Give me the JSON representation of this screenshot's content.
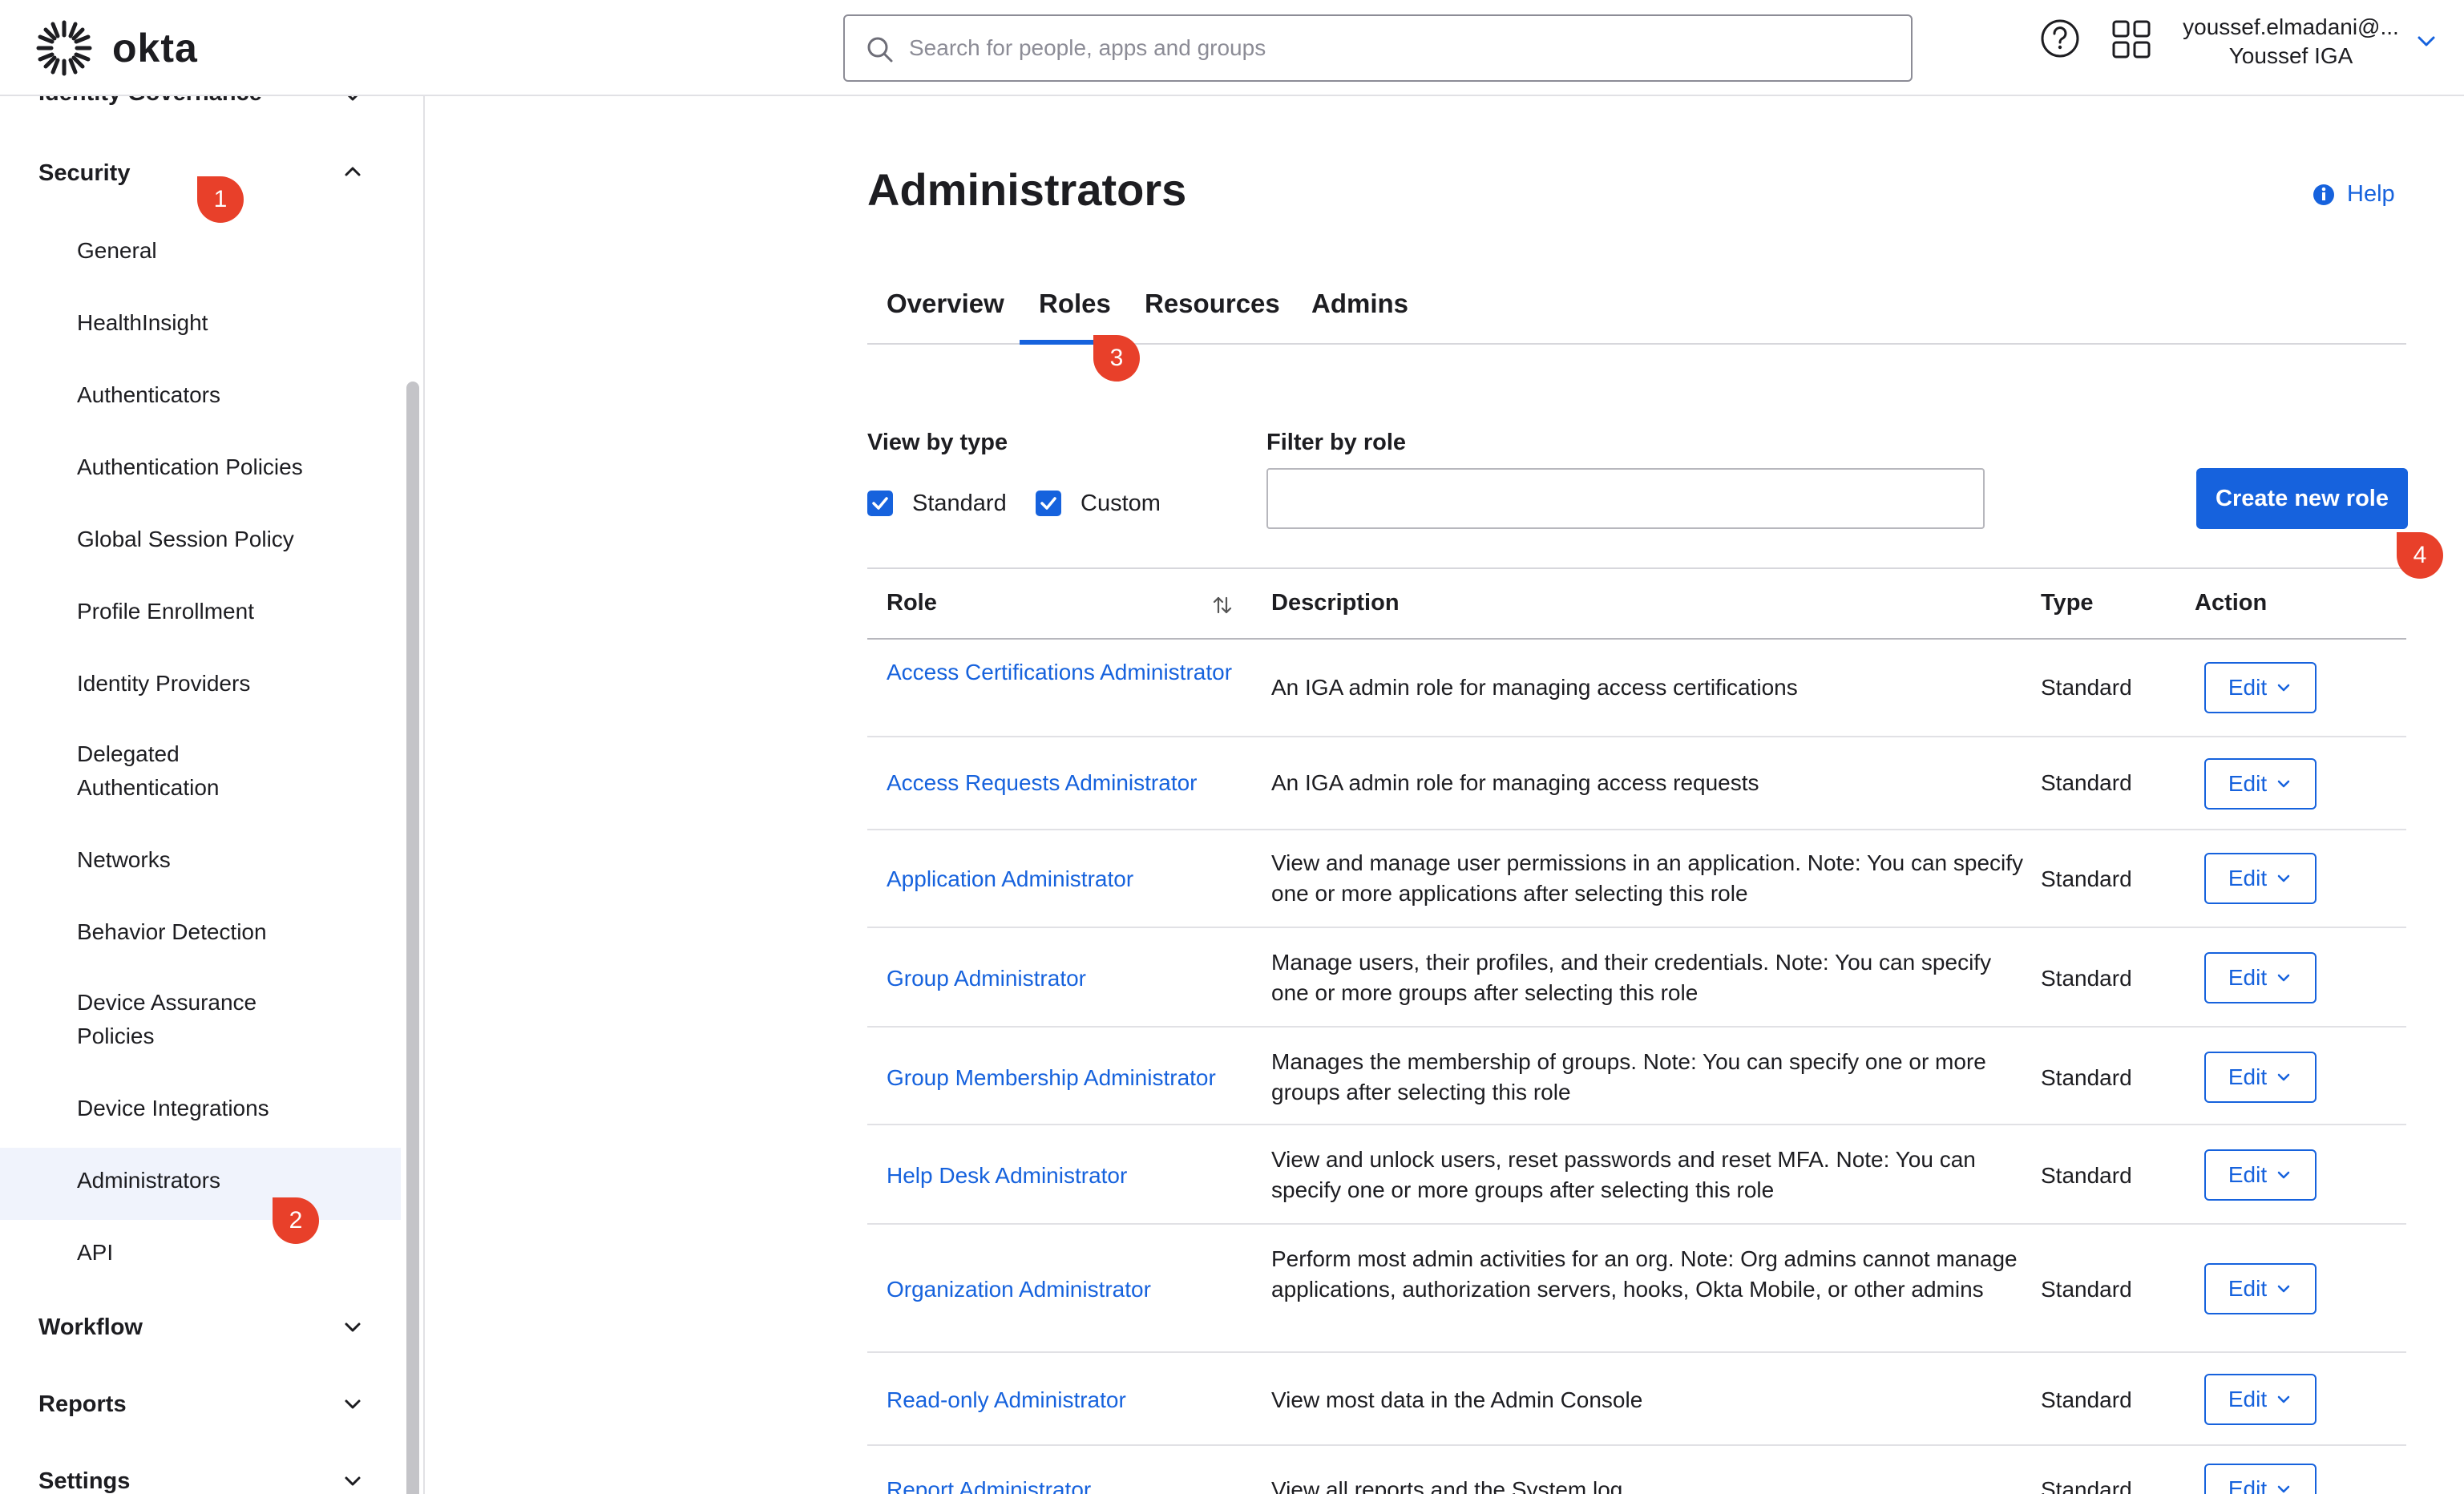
{
  "header": {
    "logo_text": "okta",
    "search_placeholder": "Search for people, apps and groups",
    "user_email": "youssef.elmadani@...",
    "user_org": "Youssef IGA"
  },
  "sidebar": {
    "partial_section": "Identity Governance",
    "security_label": "Security",
    "security_items": [
      "General",
      "HealthInsight",
      "Authenticators",
      "Authentication Policies",
      "Global Session Policy",
      "Profile Enrollment",
      "Identity Providers",
      "Delegated Authentication",
      "Networks",
      "Behavior Detection",
      "Device Assurance Policies",
      "Device Integrations",
      "Administrators",
      "API"
    ],
    "active_item": "Administrators",
    "sections_below": [
      "Workflow",
      "Reports",
      "Settings"
    ]
  },
  "page": {
    "title": "Administrators",
    "help_label": "Help",
    "tabs": [
      "Overview",
      "Roles",
      "Resources",
      "Admins"
    ],
    "active_tab": "Roles"
  },
  "filters": {
    "view_by_type_label": "View by type",
    "standard_label": "Standard",
    "custom_label": "Custom",
    "standard_checked": true,
    "custom_checked": true,
    "filter_by_role_label": "Filter by role",
    "filter_value": "",
    "create_button": "Create new role"
  },
  "table": {
    "columns": [
      "Role",
      "Description",
      "Type",
      "Action"
    ],
    "rows": [
      {
        "role": "Access Certifications Administrator",
        "description": "An IGA admin role for managing access certifications",
        "type": "Standard",
        "action": "Edit"
      },
      {
        "role": "Access Requests Administrator",
        "description": "An IGA admin role for managing access requests",
        "type": "Standard",
        "action": "Edit"
      },
      {
        "role": "Application Administrator",
        "description": "View and manage user permissions in an application. Note: You can specify one or more applications after selecting this role",
        "type": "Standard",
        "action": "Edit"
      },
      {
        "role": "Group Administrator",
        "description": "Manage users, their profiles, and their credentials. Note: You can specify one or more groups after selecting this role",
        "type": "Standard",
        "action": "Edit"
      },
      {
        "role": "Group Membership Administrator",
        "description": "Manages the membership of groups. Note: You can specify one or more groups after selecting this role",
        "type": "Standard",
        "action": "Edit"
      },
      {
        "role": "Help Desk Administrator",
        "description": "View and unlock users, reset passwords and reset MFA. Note: You can specify one or more groups after selecting this role",
        "type": "Standard",
        "action": "Edit"
      },
      {
        "role": "Organization Administrator",
        "description": "Perform most admin activities for an org. Note: Org admins cannot manage applications, authorization servers, hooks, Okta Mobile, or other admins",
        "type": "Standard",
        "action": "Edit"
      },
      {
        "role": "Read-only Administrator",
        "description": "View most data in the Admin Console",
        "type": "Standard",
        "action": "Edit"
      },
      {
        "role": "Report Administrator",
        "description": "View all reports and the System log",
        "type": "Standard",
        "action": "Edit"
      }
    ]
  },
  "step_markers": [
    "1",
    "2",
    "3",
    "4"
  ],
  "colors": {
    "accent": "#1662dd",
    "marker": "#e8402a",
    "active_nav_bg": "#f0f3fc"
  }
}
